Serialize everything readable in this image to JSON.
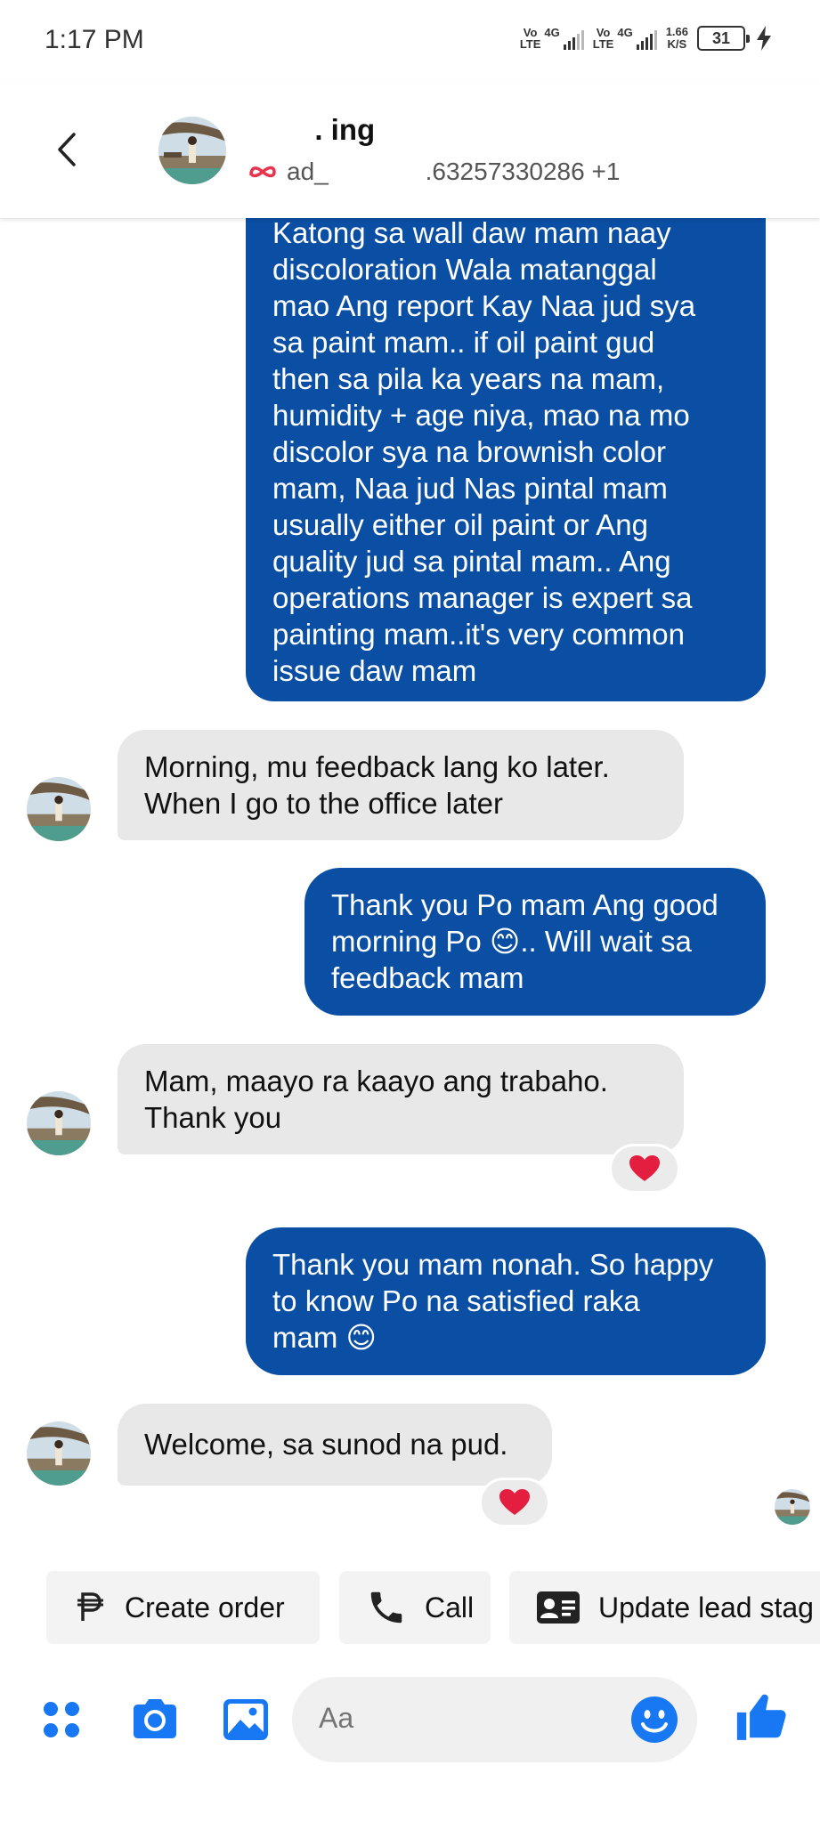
{
  "status_bar": {
    "time": "1:17 PM",
    "sim1_label_top": "Vo",
    "sim1_label_bottom": "LTE",
    "sim1_net": "4G",
    "sim2_label_top": "Vo",
    "sim2_label_bottom": "LTE",
    "sim2_net": "4G",
    "speed_value": "1.66",
    "speed_unit": "K/S",
    "battery": "31"
  },
  "header": {
    "title": "        . ing",
    "subtitle": "ad_              .63257330286 +1"
  },
  "messages": [
    {
      "direction": "outgoing",
      "lines": [
        "Katong sa wall daw mam naay",
        "discoloration Wala matanggal",
        "mao Ang report Kay Naa jud sya",
        "sa paint mam.. if oil paint gud",
        "then sa pila ka years na mam,",
        "humidity + age niya, mao na mo",
        "discolor sya na brownish color",
        "mam, Naa jud Nas pintal mam",
        "usually either oil paint or Ang",
        "quality jud sa pintal mam.. Ang",
        "operations manager is expert sa",
        "painting mam..it's very common",
        "issue daw mam"
      ]
    },
    {
      "direction": "incoming",
      "lines": [
        "Morning, mu feedback lang ko later.",
        "When I go to the office later"
      ]
    },
    {
      "direction": "outgoing",
      "lines": [
        "Thank you Po mam Ang good",
        "morning Po 😊.. Will wait sa",
        "feedback mam"
      ]
    },
    {
      "direction": "incoming",
      "lines": [
        "Mam, maayo ra kaayo ang trabaho.",
        "Thank you"
      ],
      "reaction": "heart"
    },
    {
      "direction": "outgoing",
      "lines": [
        "Thank you mam nonah. So happy",
        "to know Po na satisfied raka",
        "mam 😊"
      ]
    },
    {
      "direction": "incoming",
      "lines": [
        "Welcome, sa sunod na pud."
      ],
      "reaction": "heart"
    }
  ],
  "quick_actions": [
    {
      "label": "Create order",
      "icon": "peso-icon"
    },
    {
      "label": "Call",
      "icon": "phone-icon"
    },
    {
      "label": "Update lead stag",
      "icon": "contact-card-icon"
    }
  ],
  "composer": {
    "placeholder": "Aa"
  },
  "colors": {
    "outgoing_bubble": "#0a4fa3",
    "incoming_bubble": "#e8e8e8",
    "accent": "#1877f2",
    "heart": "#e41e3f"
  }
}
